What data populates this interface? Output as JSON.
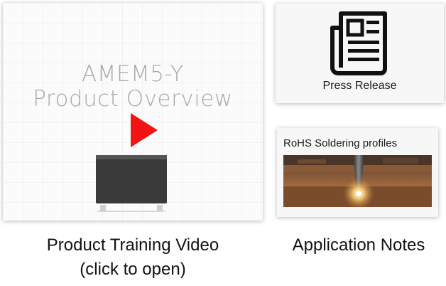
{
  "video": {
    "title_line1": "AMEM5-Y",
    "title_line2": "Product Overview",
    "caption_line1": "Product Training Video",
    "caption_line2": "(click to open)"
  },
  "press": {
    "label": "Press Release"
  },
  "notes": {
    "heading": "RoHS Soldering profiles",
    "caption": "Application Notes"
  },
  "icons": {
    "play": "play-icon",
    "product": "product-component-icon",
    "newspaper": "newspaper-icon"
  },
  "colors": {
    "play": "#f21313",
    "title_text": "#a9a9a9",
    "product_body": "#3a3a3a"
  }
}
